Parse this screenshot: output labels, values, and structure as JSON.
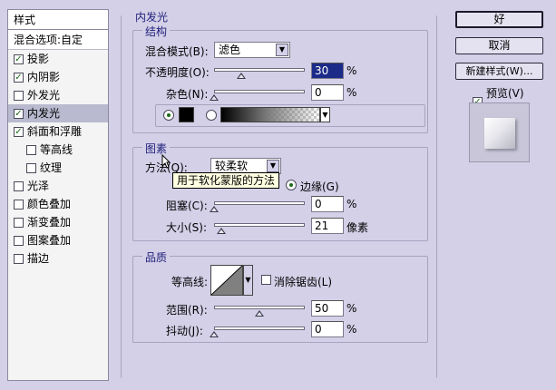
{
  "sidebar": {
    "header": "样式",
    "blend": "混合选项:自定",
    "items": [
      {
        "label": "投影",
        "checked": true
      },
      {
        "label": "内阴影",
        "checked": true
      },
      {
        "label": "外发光",
        "checked": false
      },
      {
        "label": "内发光",
        "checked": true,
        "selected": true
      },
      {
        "label": "斜面和浮雕",
        "checked": true
      },
      {
        "label": "等高线",
        "checked": false,
        "indent": true
      },
      {
        "label": "纹理",
        "checked": false,
        "indent": true
      },
      {
        "label": "光泽",
        "checked": false
      },
      {
        "label": "颜色叠加",
        "checked": false
      },
      {
        "label": "渐变叠加",
        "checked": false
      },
      {
        "label": "图案叠加",
        "checked": false
      },
      {
        "label": "描边",
        "checked": false
      }
    ]
  },
  "panel": {
    "title": "内发光",
    "structure": {
      "title": "结构",
      "blend_mode_label": "混合模式(B):",
      "blend_mode_value": "滤色",
      "opacity_label": "不透明度(O):",
      "opacity_value": "30",
      "opacity_unit": "%",
      "opacity_fraction": 0.3,
      "noise_label": "杂色(N):",
      "noise_value": "0",
      "noise_unit": "%",
      "noise_fraction": 0.0
    },
    "elements": {
      "title": "图素",
      "method_label": "方法(Q):",
      "method_value": "较柔软",
      "tooltip": "用于软化蒙版的方法",
      "edge_label": "边缘(G)",
      "choke_label": "阻塞(C):",
      "choke_value": "0",
      "choke_unit": "%",
      "choke_fraction": 0.0,
      "size_label": "大小(S):",
      "size_value": "21",
      "size_unit": "像素",
      "size_fraction": 0.08
    },
    "quality": {
      "title": "品质",
      "contour_label": "等高线:",
      "antialias_label": "消除锯齿(L)",
      "range_label": "范围(R):",
      "range_value": "50",
      "range_unit": "%",
      "range_fraction": 0.5,
      "jitter_label": "抖动(J):",
      "jitter_value": "0",
      "jitter_unit": "%",
      "jitter_fraction": 0.0
    }
  },
  "buttons": {
    "ok": "好",
    "cancel": "取消",
    "new_style": "新建样式(W)...",
    "preview": "预览(V)"
  }
}
